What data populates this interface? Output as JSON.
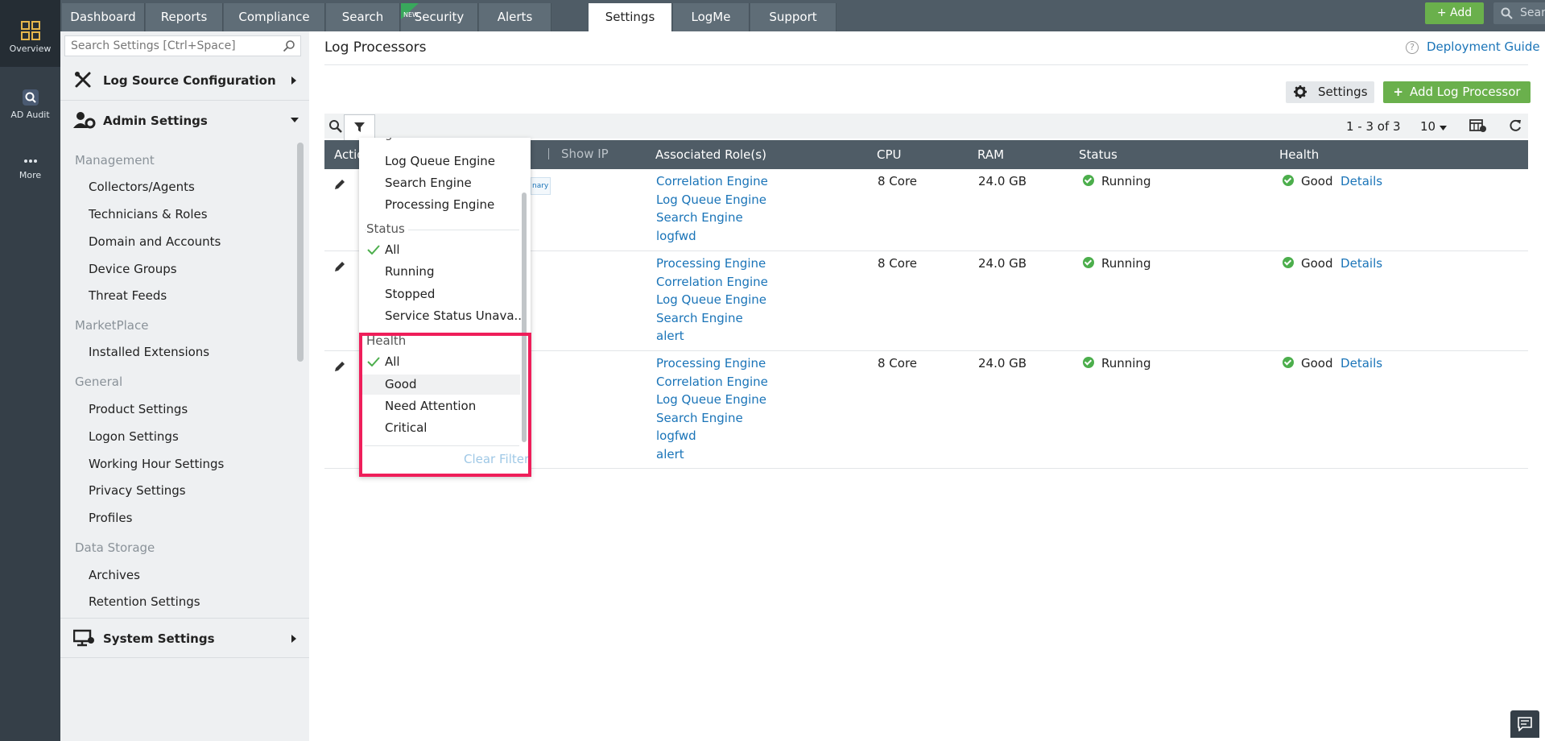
{
  "rail": {
    "items": [
      {
        "label": "Overview",
        "icon": "grid-icon"
      },
      {
        "label": "AD Audit",
        "icon": "ad-audit-icon"
      },
      {
        "label": "More",
        "icon": "more-dots-icon"
      }
    ]
  },
  "topnav": {
    "tabs": [
      "Dashboard",
      "Reports",
      "Compliance",
      "Search",
      "Security",
      "Alerts",
      "Settings",
      "LogMe",
      "Support"
    ],
    "active_tab": "Settings",
    "new_badge": "NEW",
    "add_label": "+ Add",
    "search_placeholder": "Search"
  },
  "sidebar": {
    "search_placeholder": "Search Settings [Ctrl+Space]",
    "section_log_source": "Log Source Configuration",
    "section_admin": "Admin Settings",
    "section_system": "System Settings",
    "group_management": "Management",
    "group_marketplace": "MarketPlace",
    "group_general": "General",
    "group_data_storage": "Data Storage",
    "management_items": [
      "Collectors/Agents",
      "Technicians & Roles",
      "Domain and Accounts",
      "Device Groups",
      "Threat Feeds"
    ],
    "marketplace_items": [
      "Installed Extensions"
    ],
    "general_items": [
      "Product Settings",
      "Logon Settings",
      "Working Hour Settings",
      "Privacy Settings",
      "Profiles"
    ],
    "data_storage_items": [
      "Archives",
      "Retention Settings"
    ]
  },
  "main": {
    "title": "Log Processors",
    "deployment_guide": "Deployment Guide",
    "settings_button": "Settings",
    "add_button": "Add Log Processor",
    "pager_text": "1 - 3 of 3",
    "per_page": "10",
    "columns": {
      "action": "Actio",
      "show_ip": "Show IP",
      "roles": "Associated Role(s)",
      "cpu": "CPU",
      "ram": "RAM",
      "status": "Status",
      "health": "Health"
    },
    "badge": "nary",
    "rows": [
      {
        "roles": [
          "Correlation Engine",
          "Log Queue Engine",
          "Search Engine",
          "logfwd"
        ],
        "cpu": "8 Core",
        "ram": "24.0 GB",
        "status": "Running",
        "health": "Good",
        "details": "Details"
      },
      {
        "roles": [
          "Processing Engine",
          "Correlation Engine",
          "Log Queue Engine",
          "Search Engine",
          "alert"
        ],
        "cpu": "8 Core",
        "ram": "24.0 GB",
        "status": "Running",
        "health": "Good",
        "details": "Details"
      },
      {
        "roles": [
          "Processing Engine",
          "Correlation Engine",
          "Log Queue Engine",
          "Search Engine",
          "logfwd",
          "alert"
        ],
        "cpu": "8 Core",
        "ram": "24.0 GB",
        "status": "Running",
        "health": "Good",
        "details": "Details"
      }
    ]
  },
  "filter_dropdown": {
    "role_items": [
      "Log Queue Engine",
      "Search Engine",
      "Processing Engine"
    ],
    "status_heading": "Status",
    "status_items": [
      "All",
      "Running",
      "Stopped",
      "Service Status Unava..."
    ],
    "health_heading": "Health",
    "health_items": [
      "All",
      "Good",
      "Need Attention",
      "Critical"
    ],
    "clear_filter": "Clear Filter"
  },
  "colors": {
    "rail": "#353f48",
    "topbar": "#4f5c66",
    "accent_green": "#6ab04c",
    "link_blue": "#1a74b8",
    "highlight": "#ef1e5a"
  }
}
